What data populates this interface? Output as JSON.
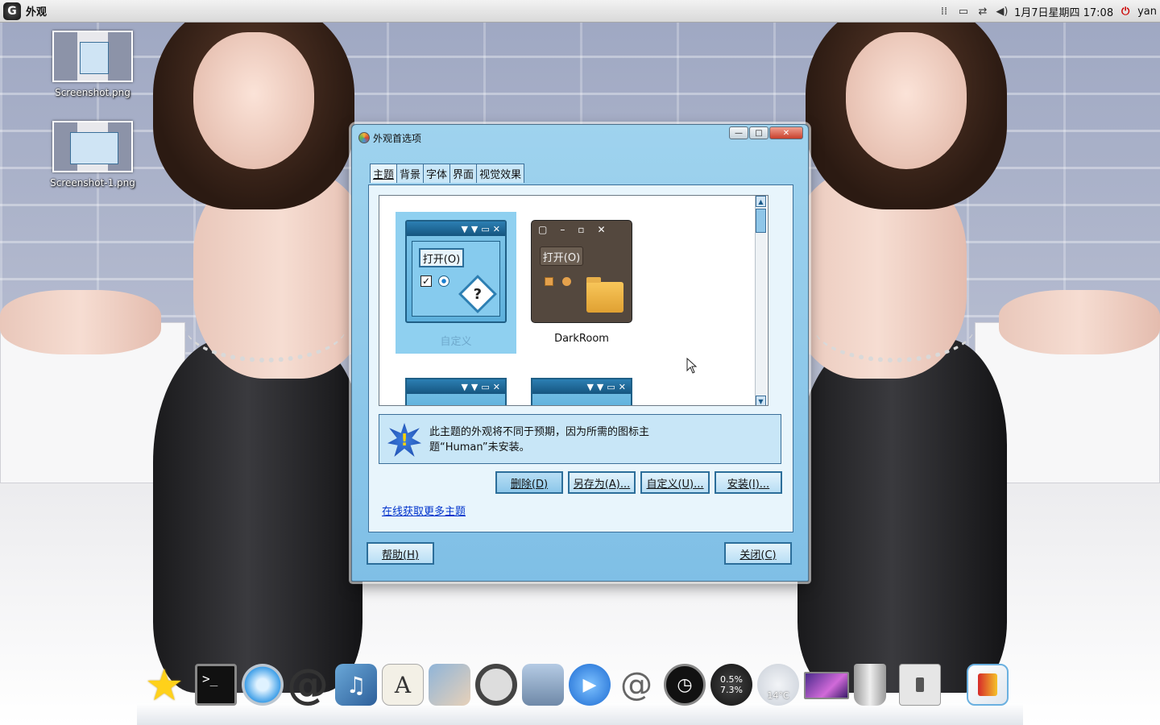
{
  "top_panel": {
    "app_logo": "G",
    "app_title": "外观",
    "datetime": "1月7日星期四 17:08",
    "user": "yan",
    "tray_icons": [
      "grip-icon",
      "monitor-icon",
      "network-icon",
      "volume-icon"
    ]
  },
  "desktop": {
    "icons": [
      {
        "label": "Screenshot.png"
      },
      {
        "label": "Screenshot-1.png"
      }
    ]
  },
  "dialog": {
    "title": "外观首选项",
    "window_buttons": {
      "minimize": "—",
      "maximize": "□",
      "close": "✕"
    },
    "tabs": [
      "主题",
      "背景",
      "字体",
      "界面",
      "视觉效果"
    ],
    "active_tab": "主题",
    "themes": [
      {
        "name": "自定义",
        "selected": true,
        "open_label": "打开(O)"
      },
      {
        "name": "DarkRoom",
        "selected": false,
        "open_label": "打开(O)"
      }
    ],
    "warning": {
      "line1": "此主题的外观将不同于预期，因为所需的图标主",
      "line2": "题“Human”未安装。"
    },
    "buttons": {
      "delete": "删除(D)",
      "save_as": "另存为(A)...",
      "customize": "自定义(U)...",
      "install": "安装(I)..."
    },
    "more_themes_link": "在线获取更多主题",
    "help_button": "帮助(H)",
    "close_button": "关闭(C)"
  },
  "dock": {
    "items": [
      "star-icon",
      "terminal-icon",
      "safari-icon",
      "mail-at-icon",
      "itunes-icon",
      "font-book-icon",
      "preview-icon",
      "headphones-icon",
      "mail-stamp-icon",
      "ichat-icon",
      "spring-icon",
      "clock-icon",
      "system-meter-icon",
      "weather-icon",
      "wallpaper-icon",
      "trash-icon",
      "light-switch-icon",
      "paint-icon"
    ],
    "meter_top": "0.5%",
    "meter_bottom": "7.3%",
    "weather_temp": "14°C"
  },
  "colors": {
    "dialog_bg": "#8fcbee",
    "selection": "#8fd0f0",
    "link": "#0033cc",
    "panel_bg": "#e8f5fc"
  }
}
